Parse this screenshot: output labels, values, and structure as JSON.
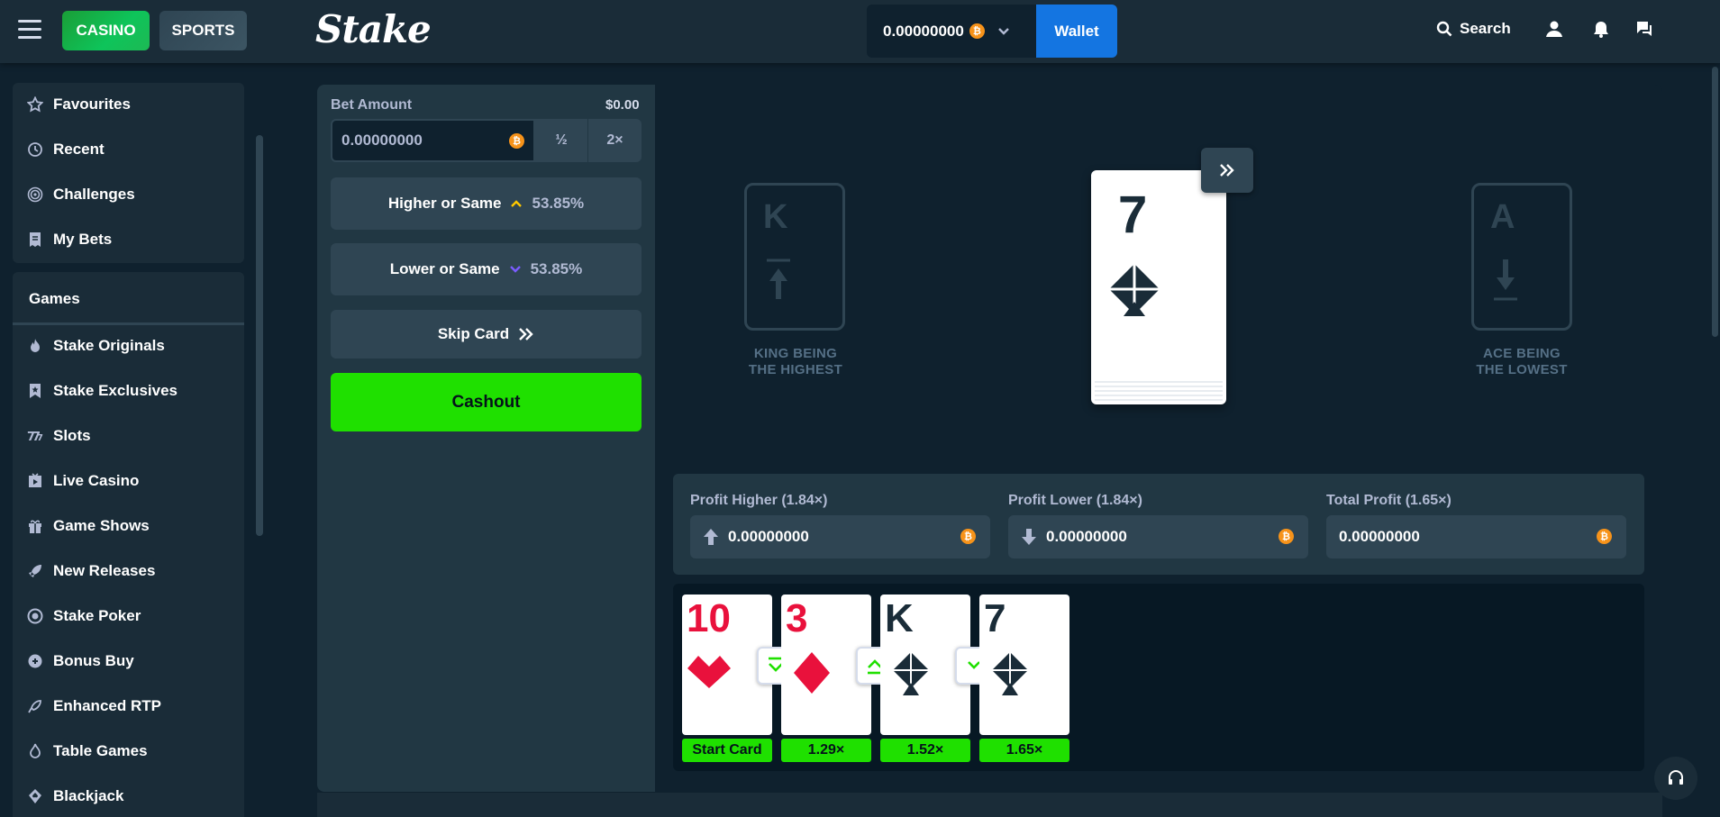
{
  "header": {
    "casino_label": "CASINO",
    "sports_label": "SPORTS",
    "logo_text": "Stake",
    "balance": "0.00000000",
    "wallet_label": "Wallet",
    "search_label": "Search"
  },
  "sidebar": {
    "top_items": [
      {
        "label": "Favourites",
        "icon": "star-icon"
      },
      {
        "label": "Recent",
        "icon": "clock-icon"
      },
      {
        "label": "Challenges",
        "icon": "target-icon"
      },
      {
        "label": "My Bets",
        "icon": "receipt-icon"
      }
    ],
    "games_header": "Games",
    "game_items": [
      {
        "label": "Stake Originals",
        "icon": "flame-icon"
      },
      {
        "label": "Stake Exclusives",
        "icon": "bookmark-star-icon"
      },
      {
        "label": "Slots",
        "icon": "slots-icon"
      },
      {
        "label": "Live Casino",
        "icon": "live-icon"
      },
      {
        "label": "Game Shows",
        "icon": "gift-icon"
      },
      {
        "label": "New Releases",
        "icon": "rocket-icon"
      },
      {
        "label": "Stake Poker",
        "icon": "poker-chip-icon"
      },
      {
        "label": "Bonus Buy",
        "icon": "bonus-icon"
      },
      {
        "label": "Enhanced RTP",
        "icon": "rocket-up-icon"
      },
      {
        "label": "Table Games",
        "icon": "table-icon"
      },
      {
        "label": "Blackjack",
        "icon": "blackjack-icon"
      }
    ]
  },
  "bet_panel": {
    "bet_amount_label": "Bet Amount",
    "bet_amount_usd": "$0.00",
    "bet_amount_value": "0.00000000",
    "half_label": "½",
    "double_label": "2×",
    "higher_label": "Higher or Same",
    "higher_pct": "53.85%",
    "lower_label": "Lower or Same",
    "lower_pct": "53.85%",
    "skip_label": "Skip Card",
    "cashout_label": "Cashout"
  },
  "stage": {
    "king_letter": "K",
    "king_caption_1": "KING BEING",
    "king_caption_2": "THE HIGHEST",
    "ace_letter": "A",
    "ace_caption_1": "ACE BEING",
    "ace_caption_2": "THE LOWEST",
    "current_card_rank": "7",
    "current_card_suit": "spades"
  },
  "profits": {
    "higher_label": "Profit Higher (1.84×)",
    "higher_value": "0.00000000",
    "lower_label": "Profit Lower (1.84×)",
    "lower_value": "0.00000000",
    "total_label": "Total Profit (1.65×)",
    "total_value": "0.00000000"
  },
  "history": [
    {
      "rank": "10",
      "suit": "hearts",
      "multiplier": "Start Card"
    },
    {
      "rank": "3",
      "suit": "diamonds",
      "multiplier": "1.29×"
    },
    {
      "rank": "K",
      "suit": "spades",
      "multiplier": "1.52×"
    },
    {
      "rank": "7",
      "suit": "spades",
      "multiplier": "1.65×"
    }
  ],
  "colors": {
    "accent_green": "#1fe000",
    "wallet_blue": "#1475e1",
    "card_red": "#e9113c",
    "bitcoin_orange": "#f7931a"
  }
}
